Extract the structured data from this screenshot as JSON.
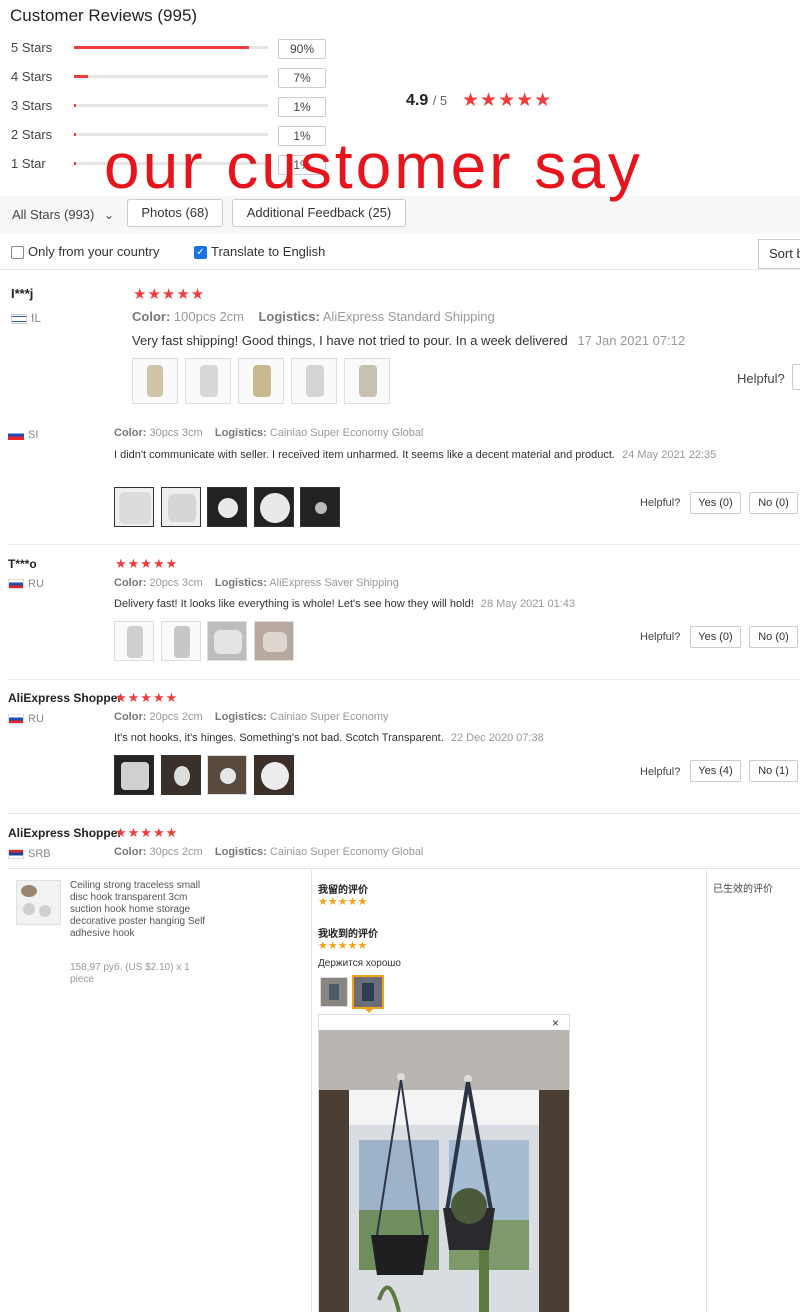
{
  "header": {
    "title": "Customer Reviews (995)"
  },
  "rating_breakdown": [
    {
      "label": "5 Stars",
      "percent": "90%",
      "fraction": 0.9
    },
    {
      "label": "4 Stars",
      "percent": "7%",
      "fraction": 0.07
    },
    {
      "label": "3 Stars",
      "percent": "1%",
      "fraction": 0.01
    },
    {
      "label": "2 Stars",
      "percent": "1%",
      "fraction": 0.01
    },
    {
      "label": "1 Star",
      "percent": "1%",
      "fraction": 0.01
    }
  ],
  "average": {
    "score": "4.9",
    "out_of": "/ 5",
    "stars": "★★★★★"
  },
  "overlay_text": "our customer say",
  "filters": {
    "all_stars": "All Stars (993)",
    "chevron": "⌄",
    "photos": "Photos (68)",
    "additional": "Additional Feedback (25)",
    "only_country": "Only from your country",
    "translate": "Translate to English",
    "translate_checked": true,
    "sort": "Sort b"
  },
  "reviews": [
    {
      "user": "I***j",
      "country": "IL",
      "stars": "★★★★★",
      "color_label": "Color:",
      "color": "100pcs 2cm",
      "logistics_label": "Logistics:",
      "logistics": "AliExpress Standard Shipping",
      "text": "Very fast shipping! Good things, I have not tried to pour. In a week delivered",
      "date": "17 Jan 2021 07:12",
      "helpful": "Helpful?"
    },
    {
      "user": "",
      "country": "SI",
      "color_label": "Color:",
      "color": "30pcs 3cm",
      "logistics_label": "Logistics:",
      "logistics": "Cainiao Super Economy Global",
      "text": "I didn't communicate with seller. I received item unharmed. It seems like a decent material and product.",
      "date": "24 May 2021",
      "time": "22:35",
      "helpful": "Helpful?",
      "yes": "Yes (0)",
      "no": "No (0)"
    },
    {
      "user": "T***o",
      "country": "RU",
      "stars": "★★★★★",
      "color_label": "Color:",
      "color": "20pcs 3cm",
      "logistics_label": "Logistics:",
      "logistics": "AliExpress Saver Shipping",
      "text": "Delivery fast! It looks like everything is whole! Let's see how they will hold!",
      "date": "28 May 2021 01:43",
      "helpful": "Helpful?",
      "yes": "Yes (0)",
      "no": "No (0)"
    },
    {
      "user": "AliExpress Shopper",
      "country": "RU",
      "stars": "★★★★★",
      "color_label": "Color:",
      "color": "20pcs 2cm",
      "logistics_label": "Logistics:",
      "logistics": "Cainiao Super Economy",
      "text": "It's not hooks, it's hinges. Something's not bad. Scotch Transparent.",
      "date": "22 Dec 2020 07:38",
      "helpful": "Helpful?",
      "yes": "Yes (4)",
      "no": "No (1)"
    },
    {
      "user": "AliExpress Shopper",
      "country": "SRB",
      "stars": "★★★★★",
      "color_label": "Color:",
      "color": "30pcs 2cm",
      "logistics_label": "Logistics:",
      "logistics": "Cainiao Super Economy Global"
    }
  ],
  "order_panel": {
    "product_title": "Ceiling strong traceless small disc hook transparent 3cm suction hook home storage decorative poster hanging Self adhesive hook",
    "price": "158,97 руб. (US $2.10) x 1 piece",
    "my_review_heading": "我留的评价",
    "received_review_heading": "我收到的评价",
    "stars": "★★★★★",
    "russian_comment": "Держится хорошо",
    "effective_review": "已生效的评价",
    "close": "×"
  },
  "colors": {
    "accent_red": "#f03c3c",
    "overlay_red": "#e8141c",
    "cn_star": "#f3a21b"
  }
}
